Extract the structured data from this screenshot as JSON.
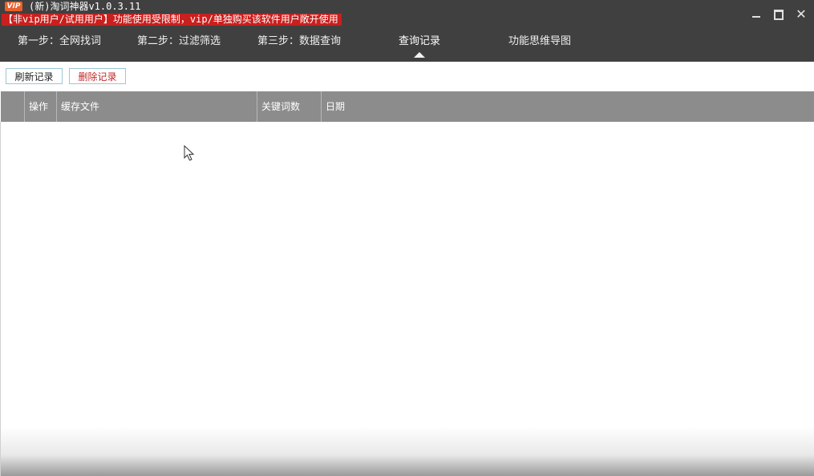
{
  "window": {
    "logo_text": "VIP",
    "title": "(新)淘词神器v1.0.3.11",
    "notice": "【非vip用户/试用用户】功能使用受限制，vip/单独购买该软件用户敞开使用"
  },
  "nav": {
    "tabs": [
      {
        "label": "第一步：全网找词"
      },
      {
        "label": "第二步：过滤筛选"
      },
      {
        "label": "第三步：数据查询"
      },
      {
        "label": "查询记录",
        "active": true
      },
      {
        "label": "功能思维导图"
      }
    ]
  },
  "toolbar": {
    "refresh_label": "刷新记录",
    "delete_label": "删除记录"
  },
  "table": {
    "columns": [
      "",
      "操作",
      "缓存文件",
      "关键词数",
      "日期"
    ],
    "rows": []
  },
  "colors": {
    "titlebar": "#404040",
    "notice_bg": "#c8201e",
    "header_bg": "#8c8c8c",
    "delete_text": "#c0282a"
  }
}
